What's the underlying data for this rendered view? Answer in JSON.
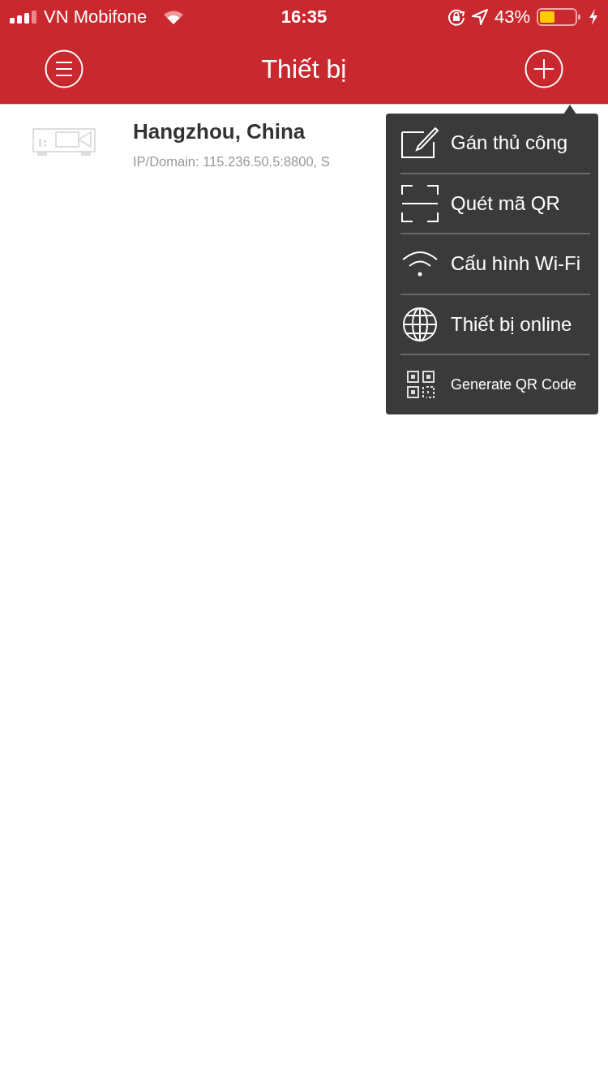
{
  "status_bar": {
    "carrier": "VN Mobifone",
    "time": "16:35",
    "battery": "43%"
  },
  "nav": {
    "title": "Thiết bị"
  },
  "devices": [
    {
      "name": "Hangzhou, China",
      "detail": "IP/Domain: 115.236.50.5:8800, S"
    }
  ],
  "menu": [
    {
      "kind": "edit",
      "label": "Gán thủ công"
    },
    {
      "kind": "scan",
      "label": "Quét mã QR"
    },
    {
      "kind": "wifi",
      "label": "Cấu hình Wi-Fi"
    },
    {
      "kind": "globe",
      "label": "Thiết bị online"
    },
    {
      "kind": "qr",
      "label": "Generate QR Code"
    }
  ]
}
